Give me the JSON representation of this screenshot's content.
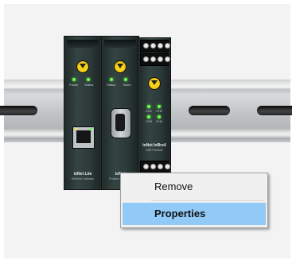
{
  "device_modules": [
    {
      "name": "ioNet Lite",
      "subtitle": "Ethernet Gateway",
      "led_labels": [
        "Power",
        "Status"
      ]
    },
    {
      "name": "ioNet",
      "subtitle": "Profibus Gateway",
      "led_labels": [
        "Status",
        "Token"
      ]
    },
    {
      "name": "ioNet InBrs4",
      "subtitle": "HART Module",
      "led_labels": [
        "CH1",
        "CH2",
        "CH3",
        "CH4"
      ]
    }
  ],
  "context_menu": {
    "items": [
      {
        "label": "Remove",
        "highlighted": false
      },
      {
        "label": "Properties",
        "highlighted": true
      }
    ],
    "highlight_color": "#91c9f7"
  },
  "colors": {
    "module_body": "#2f3e3d",
    "led_on": "#6cff4a",
    "badge": "#f7d21b"
  }
}
